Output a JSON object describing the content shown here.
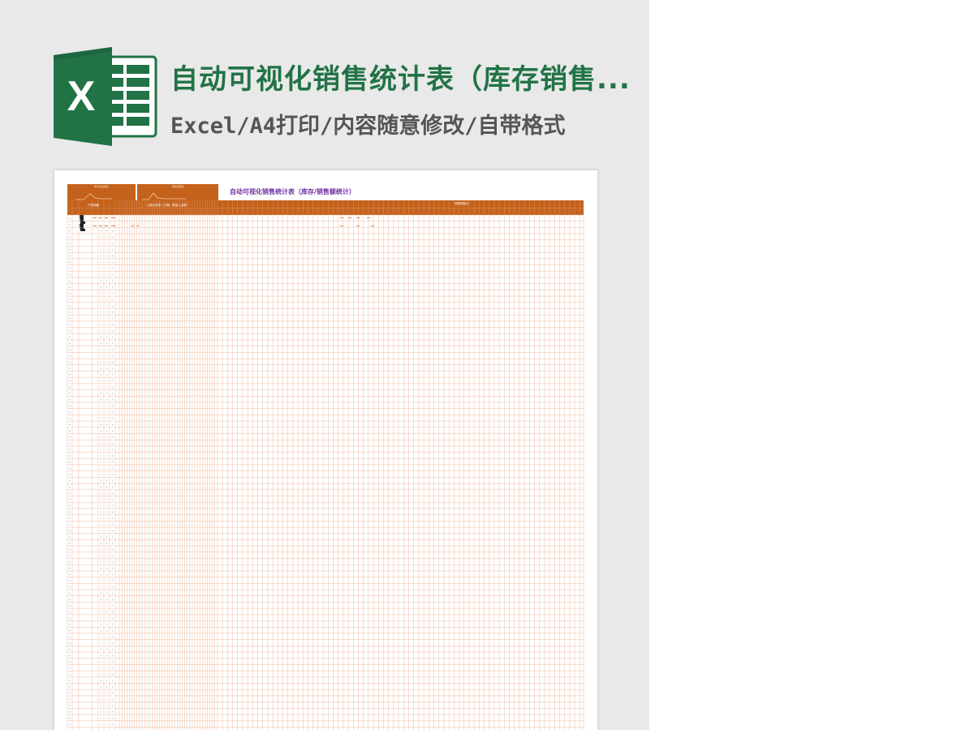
{
  "banner": {
    "title": "自动可视化销售统计表（库存销售...",
    "subtitle": "Excel/A4打印/内容随意修改/自带格式",
    "logo_letter": "X"
  },
  "colors": {
    "panel_bg": "#e9e9e9",
    "excel_green": "#217346",
    "excel_green_dark": "#185c37",
    "header_orange": "#c4621c",
    "grid_line": "#e8a07a",
    "sheet_title": "#7030a0",
    "subtitle_gray": "#555555"
  },
  "sheet": {
    "title": "自动可视化销售统计表（库存/销售额统计）",
    "mini_charts": [
      {
        "title": "库存余量趋势"
      },
      {
        "title": "销售额趋势"
      }
    ],
    "header_blocks": [
      {
        "label": "产品明细"
      },
      {
        "label": "入库记录表（日期、数量入品牌）"
      },
      {
        "label": "销售额统计"
      }
    ]
  }
}
